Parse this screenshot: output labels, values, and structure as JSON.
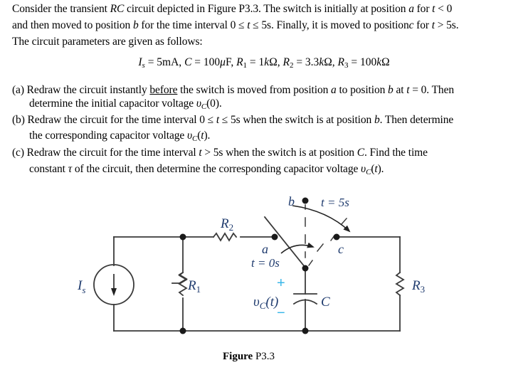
{
  "intro": {
    "line1": {
      "t1": "Consider the transient ",
      "rc": "RC",
      "t2": " circuit depicted in Figure P3.3. The switch is initially at position ",
      "a": "a",
      "t3": " for ",
      "tvar": "t",
      "t4": " < 0"
    },
    "line2": {
      "t1": "and then moved to position ",
      "b": "b",
      "t2": " for the time interval 0 ≤ ",
      "tvar": "t",
      "t3": " ≤ 5s. Finally, it is moved to position",
      "c": "c",
      "t4": " for ",
      "tvar2": "t",
      "t5": " > 5s."
    },
    "line3": "The circuit parameters are given as follows:"
  },
  "params": {
    "is": {
      "sym": "I",
      "sub": "s",
      "val": " = 5mA, "
    },
    "c": {
      "sym": "C",
      "val": " = 100",
      "mu": "μ",
      "unit": "F, "
    },
    "r1": {
      "sym": "R",
      "sub": "1",
      "val": " = 1",
      "k": "k",
      "unit": "Ω, "
    },
    "r2": {
      "sym": "R",
      "sub": "2",
      "val": " = 3.3",
      "k": "k",
      "unit": "Ω, "
    },
    "r3": {
      "sym": "R",
      "sub": "3",
      "val": " = 100",
      "k": "k",
      "unit": "Ω"
    }
  },
  "questions": {
    "a": {
      "l1a": "(a) Redraw the circuit instantly ",
      "before": "before",
      "l1b": " the switch is moved from position ",
      "a": "a",
      "l1c": " to position ",
      "b": "b",
      "l1d": " at ",
      "t": "t",
      "l1e": " = 0. Then",
      "l2a": "determine the initial capacitor voltage ",
      "v": "υ",
      "vsub": "C",
      "l2b": "(0)."
    },
    "b": {
      "l1a": "(b) Redraw the circuit for the time interval 0 ≤ ",
      "t": "t",
      "l1b": " ≤ 5s  when the switch is at position ",
      "b": "b",
      "l1c": ". Then determine",
      "l2a": "the corresponding capacitor voltage ",
      "v": "υ",
      "vsub": "C",
      "l2b": "(",
      "t2": "t",
      "l2c": ")."
    },
    "c": {
      "l1a": "(c) Redraw the circuit for the time interval ",
      "t": "t",
      "l1b": " > 5s  when the switch is at position ",
      "c": "C",
      "l1c": ". Find the time",
      "l2a": "constant ",
      "tau": "τ",
      "l2b": " of the circuit, then determine the corresponding capacitor voltage ",
      "v": "υ",
      "vsub": "C",
      "l2c": "(",
      "t2": "t",
      "l2d": ")."
    }
  },
  "figure": {
    "labels": {
      "is": "I",
      "is_sub": "s",
      "r1": "R",
      "r1_sub": "1",
      "r2": "R",
      "r2_sub": "2",
      "r3": "R",
      "r3_sub": "3",
      "c": "C",
      "a": "a",
      "b": "b",
      "cpos": "c",
      "t0": "t = 0s",
      "t5": "t = 5s",
      "plus": "+",
      "minus": "−",
      "vc": "υ",
      "vc_sub": "C",
      "vc_arg": "(t)"
    },
    "colors": {
      "wire": "#3a3a3a",
      "label": "#1f3b6e",
      "polarity": "#38b6e8"
    },
    "caption": {
      "bold": "Figure",
      "rest": " P3.3"
    }
  }
}
